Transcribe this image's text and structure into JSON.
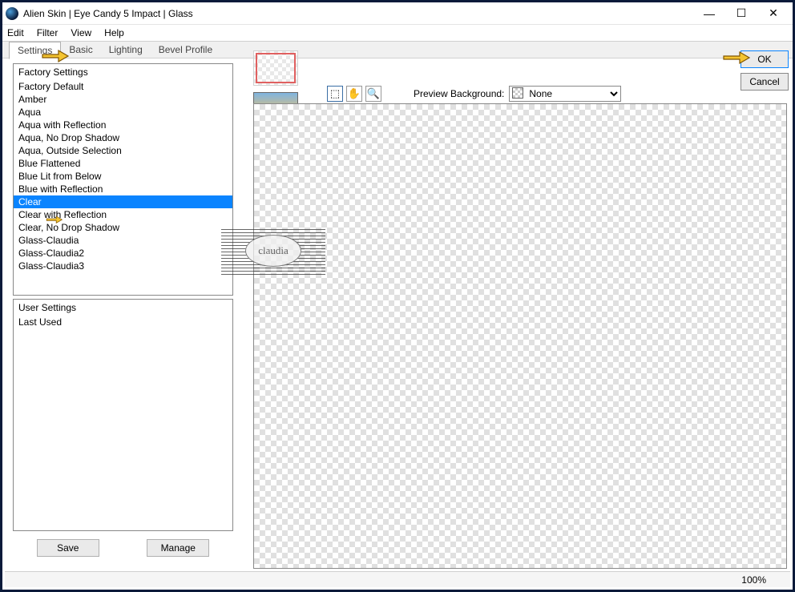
{
  "window": {
    "title": "Alien Skin | Eye Candy 5 Impact | Glass",
    "minimize": "—",
    "maximize": "☐",
    "close": "✕"
  },
  "menu": {
    "edit": "Edit",
    "filter": "Filter",
    "view": "View",
    "help": "Help"
  },
  "tabs": {
    "settings": "Settings",
    "basic": "Basic",
    "lighting": "Lighting",
    "bevel": "Bevel Profile"
  },
  "factory": {
    "header": "Factory Settings",
    "items": [
      "Factory Default",
      "Amber",
      "Aqua",
      "Aqua with Reflection",
      "Aqua, No Drop Shadow",
      "Aqua, Outside Selection",
      "Blue Flattened",
      "Blue Lit from Below",
      "Blue with Reflection",
      "Clear",
      "Clear with Reflection",
      "Clear, No Drop Shadow",
      "Glass-Claudia",
      "Glass-Claudia2",
      "Glass-Claudia3"
    ],
    "selected_index": 9
  },
  "user": {
    "header": "User Settings",
    "items": [
      "Last Used"
    ]
  },
  "buttons": {
    "save": "Save",
    "manage": "Manage",
    "ok": "OK",
    "cancel": "Cancel"
  },
  "preview": {
    "label": "Preview Background:",
    "value": "None"
  },
  "status": {
    "zoom": "100%"
  },
  "watermark": "claudia"
}
